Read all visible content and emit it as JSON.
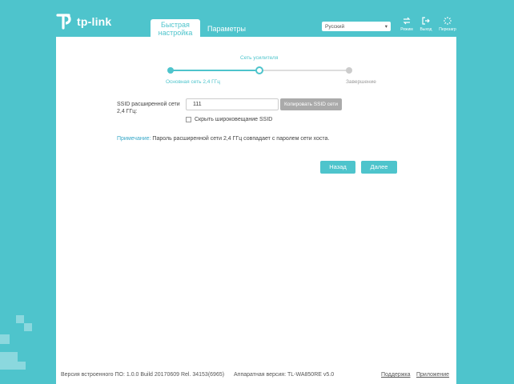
{
  "header": {
    "logo_text": "tp-link",
    "tabs": [
      {
        "label": "Быстрая настройка"
      },
      {
        "label": "Параметры"
      }
    ],
    "language": "Русский",
    "buttons": {
      "mode": "Режим",
      "logout": "Выход",
      "reboot": "Перезагр"
    }
  },
  "wizard": {
    "steps": [
      {
        "label": "Основная сеть 2,4 ГГц",
        "state": "done"
      },
      {
        "label": "Сеть усилителя",
        "state": "current"
      },
      {
        "label": "Завершение",
        "state": "pending"
      }
    ]
  },
  "form": {
    "ssid_label": "SSID расширенной сети 2,4 ГГц:",
    "ssid_value": "111",
    "copy_button": "Копировать SSID сети",
    "hide_ssid_label": "Скрыть широковещание SSID",
    "hide_ssid_checked": false
  },
  "note": {
    "label": "Примечание:",
    "text": "Пароль расширенной сети 2,4 ГГц совпадает с паролем сети хоста."
  },
  "actions": {
    "back": "Назад",
    "next": "Далее"
  },
  "footer": {
    "firmware": "Версия встроенного ПО: 1.0.0 Build 20170609 Rel. 34153(6965)",
    "hardware": "Аппаратная версия: TL-WA850RE v5.0",
    "support": "Поддержка",
    "app": "Приложение"
  },
  "colors": {
    "accent": "#4ec4cc",
    "link": "#3aa9c9",
    "pending": "#cccccc"
  }
}
